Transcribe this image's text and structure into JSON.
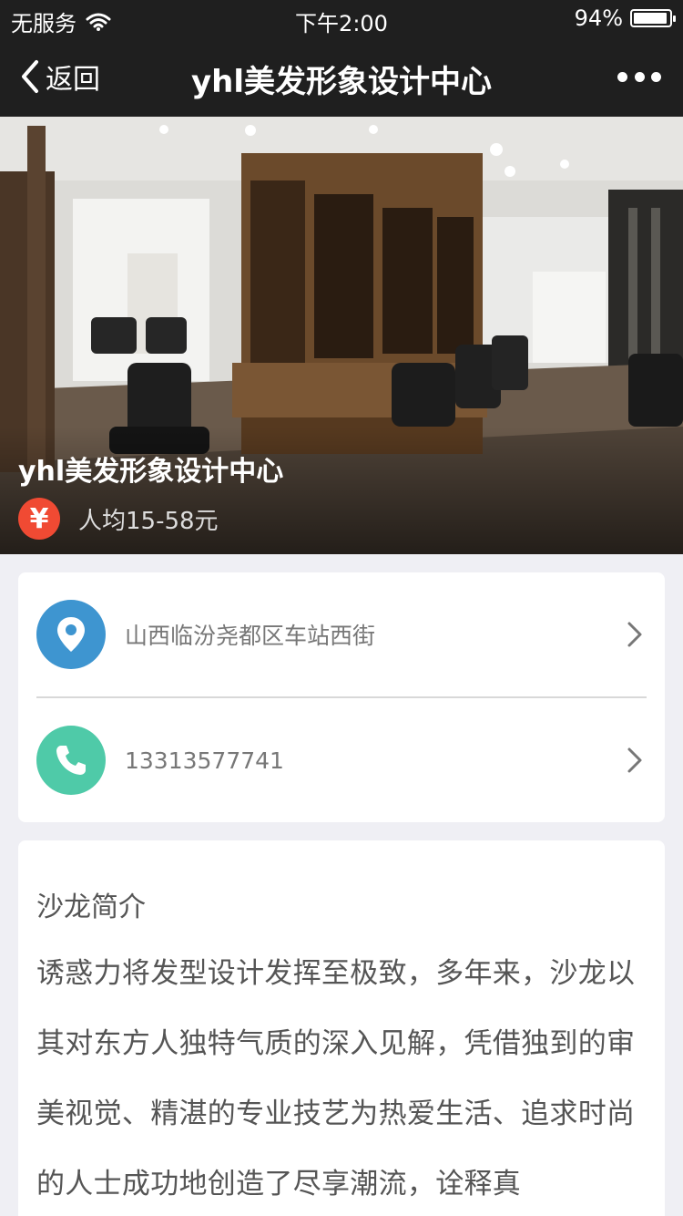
{
  "status_bar": {
    "carrier": "无服务",
    "time": "下午2:00",
    "battery": "94%",
    "battery_level": 0.94
  },
  "nav": {
    "back_label": "返回",
    "title": "yhl美发形象设计中心"
  },
  "hero": {
    "title": "yhl美发形象设计中心",
    "price_symbol": "¥",
    "price_text": "人均15-58元"
  },
  "contact": {
    "address": "山西临汾尧都区车站西街",
    "phone": "13313577741"
  },
  "intro": {
    "heading": "沙龙简介",
    "body": "诱惑力将发型设计发挥至极致，多年来，沙龙以其对东方人独特气质的深入见解，凭借独到的审美视觉、精湛的专业技艺为热爱生活、追求时尚的人士成功地创造了尽享潮流，诠释真"
  },
  "colors": {
    "nav_bg": "#1f1f1f",
    "yen_badge": "#f04a33",
    "location_icon": "#3e95d0",
    "phone_icon": "#4fcaa8",
    "page_bg": "#efeff4"
  },
  "icons": {
    "wifi": "wifi-icon",
    "back": "chevron-left-icon",
    "more": "more-icon",
    "location": "location-pin-icon",
    "phone": "phone-icon",
    "chevron": "chevron-right-icon"
  }
}
